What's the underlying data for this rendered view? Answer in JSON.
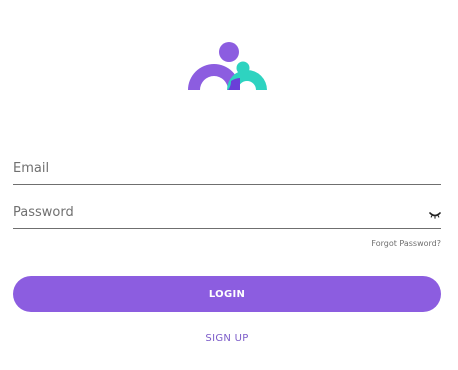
{
  "logo": {
    "icon": "family-logo-icon",
    "colors": {
      "purple": "#8c5de0",
      "teal": "#2ed3c0",
      "overlap": "#6a3fd8"
    }
  },
  "form": {
    "email_placeholder": "Email",
    "password_placeholder": "Password",
    "password_toggle_icon": "eye-closed-icon",
    "forgot_label": "Forgot Password?",
    "login_label": "LOGIN",
    "signup_label": "SIGN UP"
  },
  "colors": {
    "accent": "#8c5de0",
    "link": "#7c5cc9",
    "underline": "#6f6f6f"
  }
}
